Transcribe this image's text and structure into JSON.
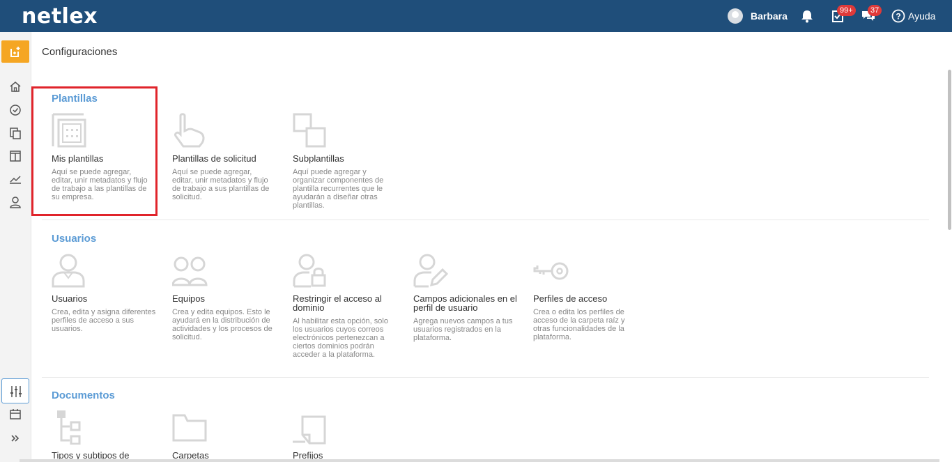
{
  "header": {
    "logo": "netlex",
    "user_name": "Barbara",
    "tasks_badge": "99+",
    "messages_badge": "37",
    "help_label": "Ayuda"
  },
  "page": {
    "title": "Configuraciones"
  },
  "sections": [
    {
      "title": "Plantillas",
      "cards": [
        {
          "title": "Mis plantillas",
          "desc": "Aquí se puede agregar, editar, unir metadatos y flujo de trabajo a las plantillas de su empresa.",
          "icon": "templates-icon"
        },
        {
          "title": "Plantillas de solicitud",
          "desc": "Aquí se puede agregar, editar, unir metadatos y flujo de trabajo a sus plantillas de solicitud.",
          "icon": "hand-pointer-icon"
        },
        {
          "title": "Subplantillas",
          "desc": "Aquí puede agregar y organizar componentes de plantilla recurrentes que le ayudarán a diseñar otras plantillas.",
          "icon": "subtemplates-icon"
        }
      ]
    },
    {
      "title": "Usuarios",
      "cards": [
        {
          "title": "Usuarios",
          "desc": "Crea, edita y asigna diferentes perfiles de acceso a sus usuarios.",
          "icon": "user-icon"
        },
        {
          "title": "Equipos",
          "desc": "Crea y edita equipos. Esto le ayudará en la distribución de actividades y los procesos de solicitud.",
          "icon": "team-icon"
        },
        {
          "title": "Restringir el acceso al dominio",
          "desc": "Al habilitar esta opción, solo los usuarios cuyos correos electrónicos pertenezcan a ciertos dominios podrán acceder a la plataforma.",
          "icon": "user-lock-icon"
        },
        {
          "title": "Campos adicionales en el perfil de usuario",
          "desc": "Agrega nuevos campos a tus usuarios registrados en la plataforma.",
          "icon": "user-edit-icon"
        },
        {
          "title": "Perfiles de acceso",
          "desc": "Crea o edita los perfiles de acceso de la carpeta raíz y otras funcionalidades de la plataforma.",
          "icon": "key-icon"
        }
      ]
    },
    {
      "title": "Documentos",
      "cards": [
        {
          "title": "Tipos y subtipos de",
          "icon": "hierarchy-icon"
        },
        {
          "title": "Carpetas",
          "icon": "folder-icon"
        },
        {
          "title": "Prefijos",
          "icon": "prefix-icon"
        }
      ]
    }
  ]
}
